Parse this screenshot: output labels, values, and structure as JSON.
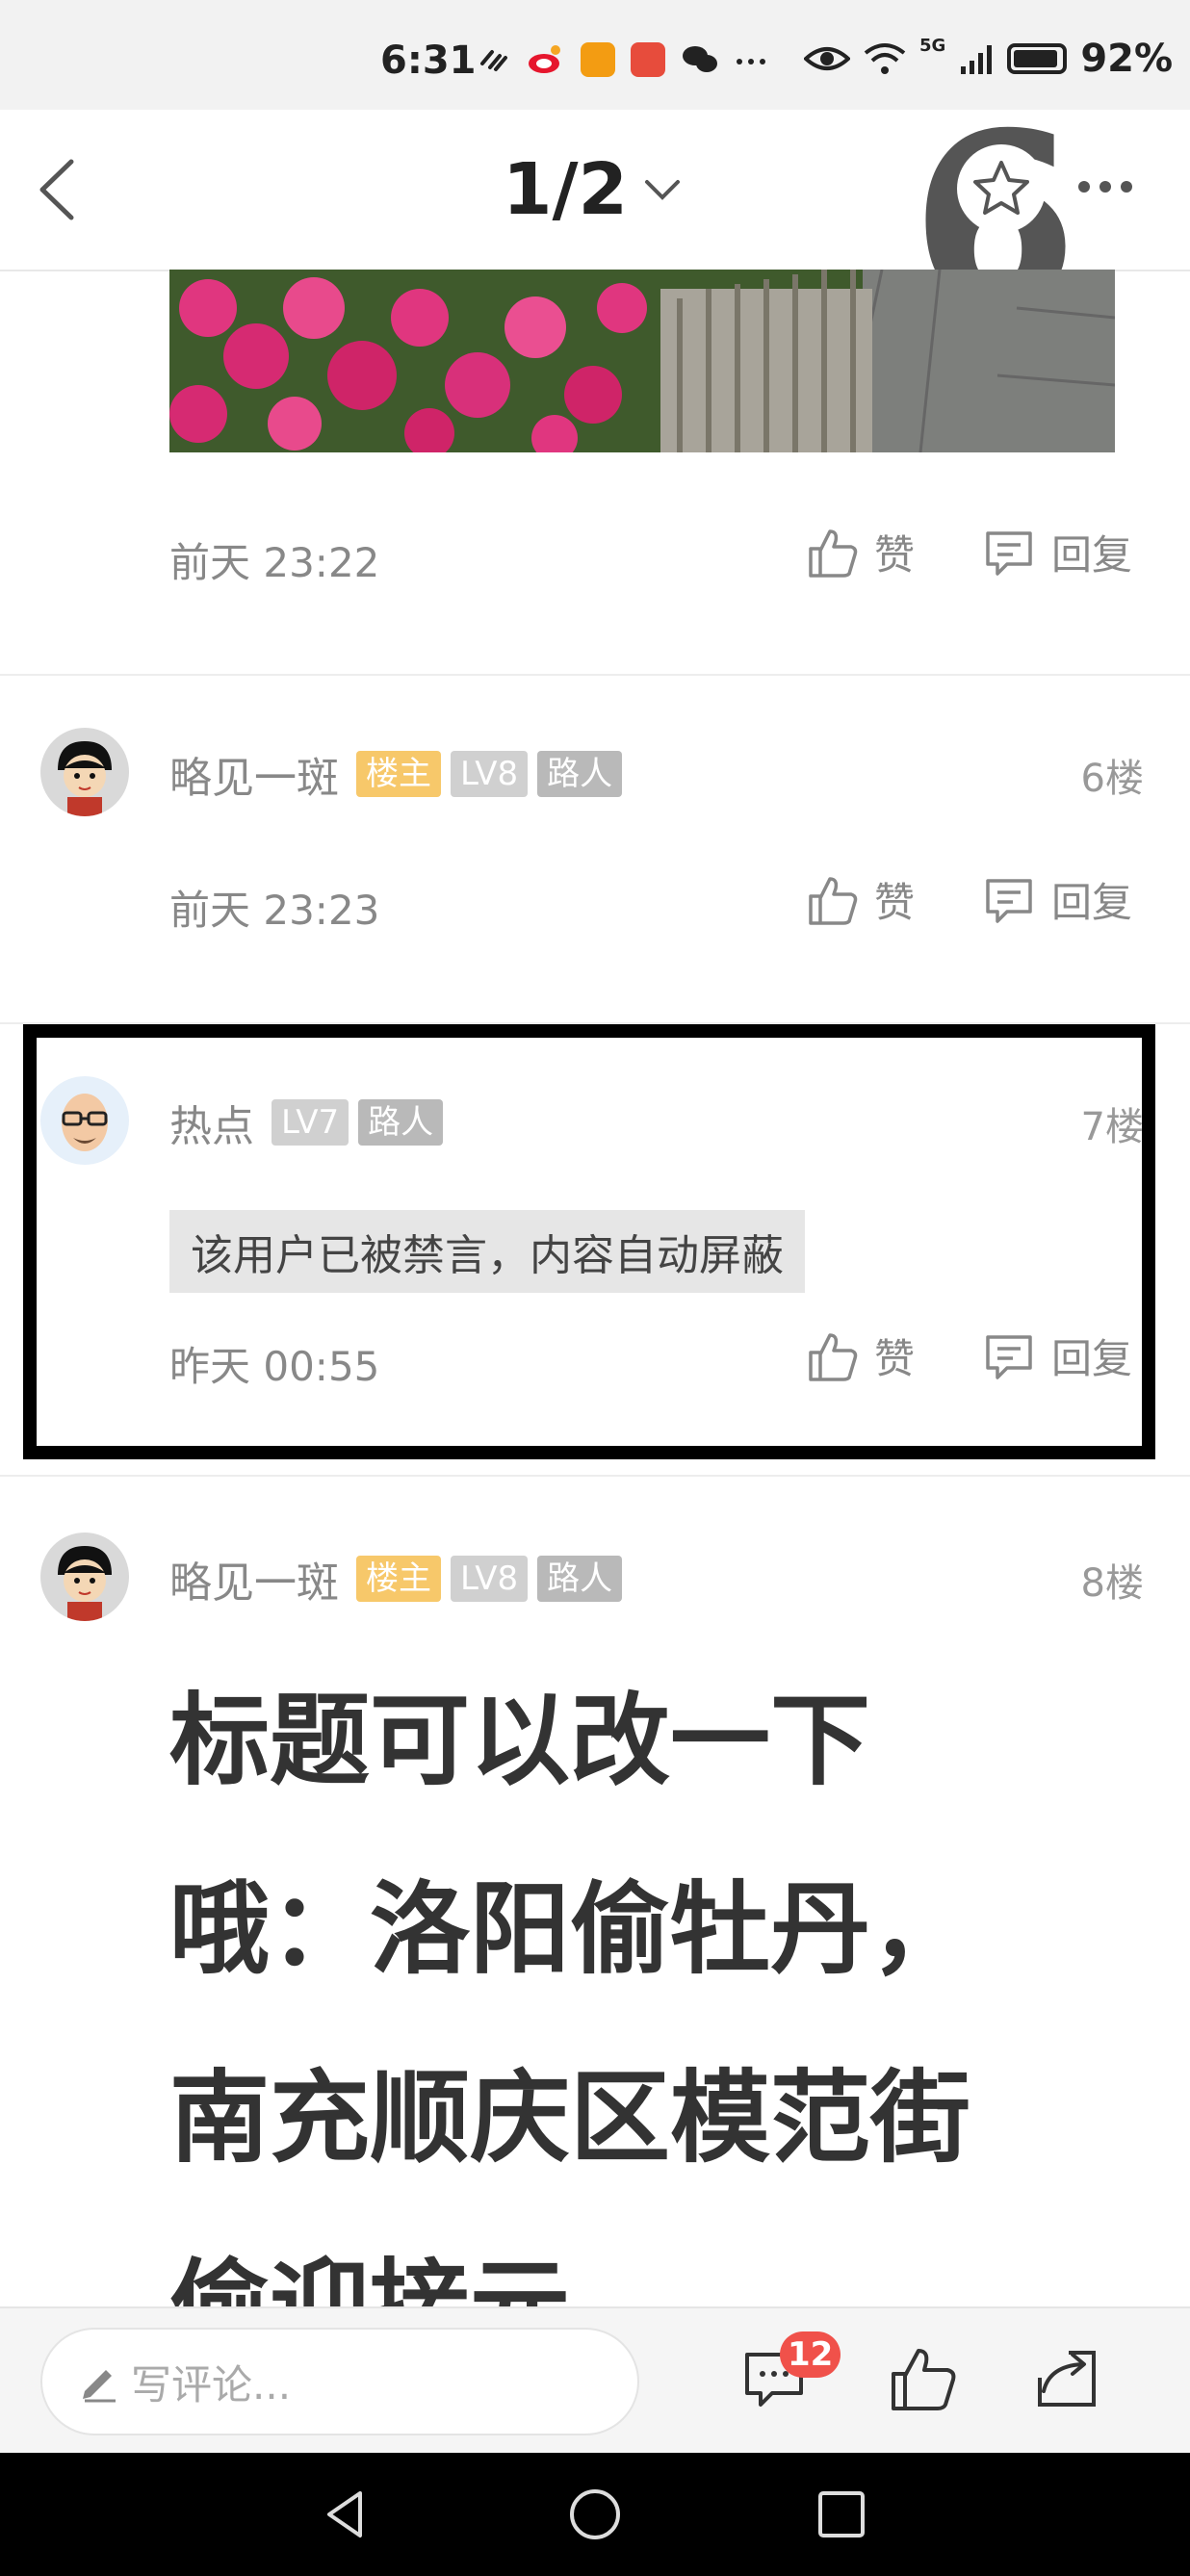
{
  "status_bar": {
    "time": "6:31",
    "network": "5G",
    "battery": "92%"
  },
  "header": {
    "page_indicator": "1/2",
    "overlay_number": "6"
  },
  "comments": [
    {
      "time": "前天 23:22",
      "like_label": "赞",
      "reply_label": "回复"
    },
    {
      "username": "略见一斑",
      "host_badge": "楼主",
      "level": "LV8",
      "role": "路人",
      "floor": "6楼",
      "time": "前天 23:23",
      "like_label": "赞",
      "reply_label": "回复"
    },
    {
      "username": "热点",
      "level": "LV7",
      "role": "路人",
      "floor": "7楼",
      "blocked_text": "该用户已被禁言，内容自动屏蔽",
      "time": "昨天 00:55",
      "like_label": "赞",
      "reply_label": "回复"
    },
    {
      "username": "略见一斑",
      "host_badge": "楼主",
      "level": "LV8",
      "role": "路人",
      "floor": "8楼",
      "content": "标题可以改一下哦：洛阳偷牡丹，南充顺庆区模范街偷迎接元"
    }
  ],
  "bottom_bar": {
    "comment_placeholder": "写评论...",
    "comment_count": "12"
  },
  "colors": {
    "host_badge": "#f7c86a",
    "level_badge": "#d0d0d0",
    "role_badge": "#b9b9b9",
    "count_badge": "#f0514a",
    "highlight_border": "#000000"
  }
}
